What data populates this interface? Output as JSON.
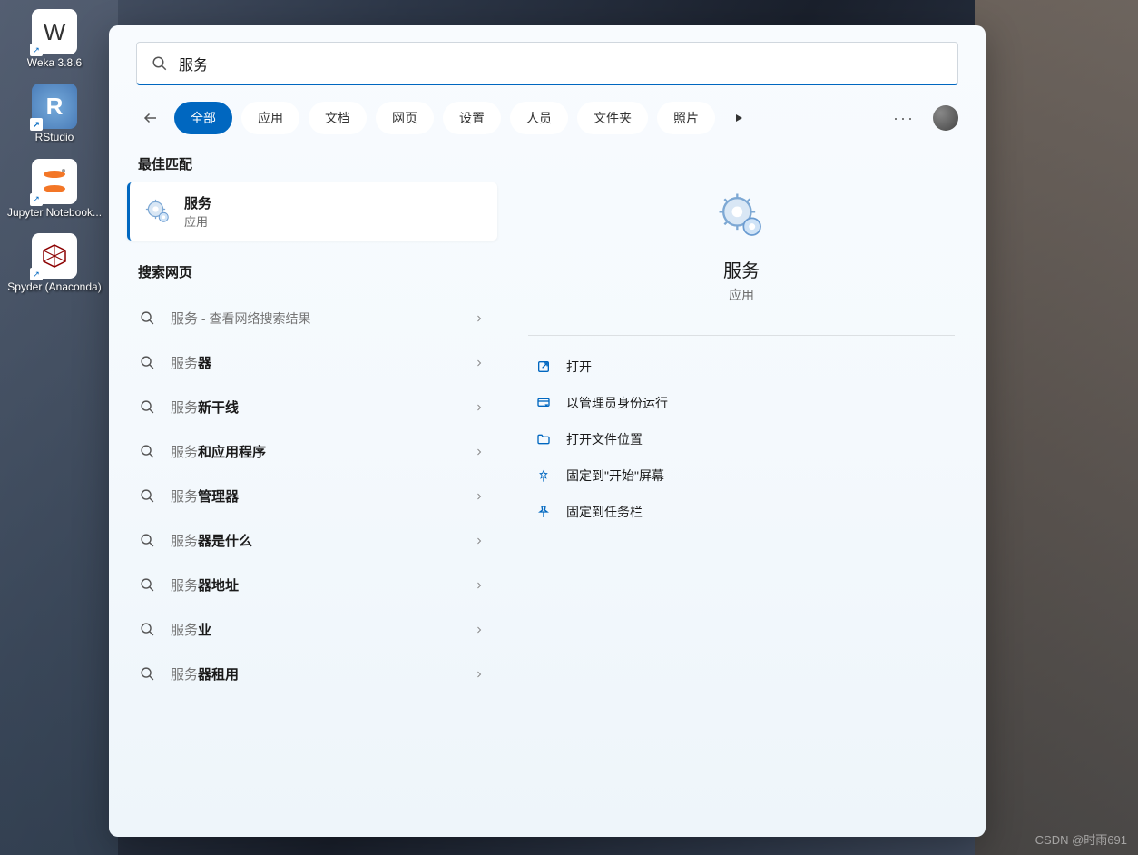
{
  "desktop": {
    "icons": [
      {
        "label": "Weka 3.8.6"
      },
      {
        "label": "RStudio"
      },
      {
        "label": "Jupyter Notebook..."
      },
      {
        "label": "Spyder (Anaconda)"
      }
    ]
  },
  "search": {
    "query": "服务",
    "tabs": [
      "全部",
      "应用",
      "文档",
      "网页",
      "设置",
      "人员",
      "文件夹",
      "照片"
    ],
    "active_tab_index": 0
  },
  "best_match": {
    "header": "最佳匹配",
    "title": "服务",
    "subtitle": "应用"
  },
  "web": {
    "header": "搜索网页",
    "items": [
      {
        "prefix": "服务",
        "bold": "",
        "hint": " - 查看网络搜索结果"
      },
      {
        "prefix": "服务",
        "bold": "器",
        "hint": ""
      },
      {
        "prefix": "服务",
        "bold": "新干线",
        "hint": ""
      },
      {
        "prefix": "服务",
        "bold": "和应用程序",
        "hint": ""
      },
      {
        "prefix": "服务",
        "bold": "管理器",
        "hint": ""
      },
      {
        "prefix": "服务",
        "bold": "器是什么",
        "hint": ""
      },
      {
        "prefix": "服务",
        "bold": "器地址",
        "hint": ""
      },
      {
        "prefix": "服务",
        "bold": "业",
        "hint": ""
      },
      {
        "prefix": "服务",
        "bold": "器租用",
        "hint": ""
      }
    ]
  },
  "preview": {
    "title": "服务",
    "subtitle": "应用",
    "actions": [
      {
        "icon": "open",
        "label": "打开"
      },
      {
        "icon": "admin",
        "label": "以管理员身份运行"
      },
      {
        "icon": "folder",
        "label": "打开文件位置"
      },
      {
        "icon": "pin-start",
        "label": "固定到\"开始\"屏幕"
      },
      {
        "icon": "pin-taskbar",
        "label": "固定到任务栏"
      }
    ]
  },
  "watermark": "CSDN @时雨691",
  "colors": {
    "accent": "#0067c0"
  }
}
